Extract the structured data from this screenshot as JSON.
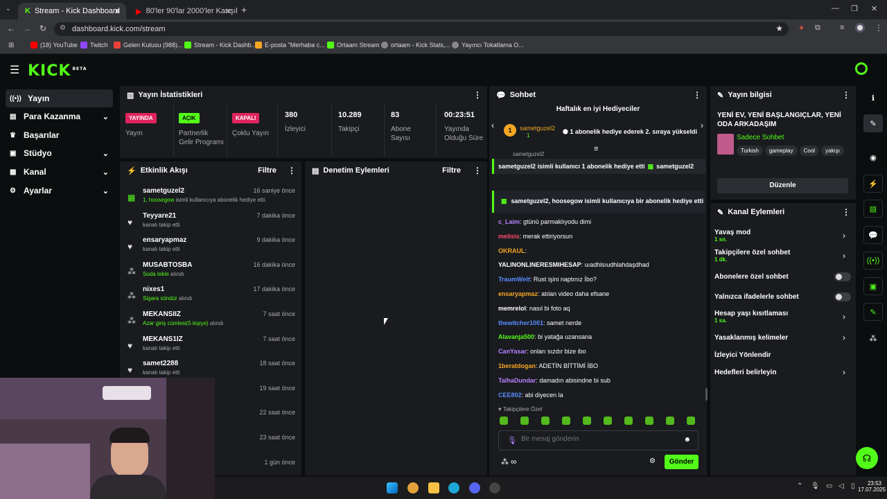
{
  "browser": {
    "tabs": [
      {
        "label": "Stream - Kick Dashboard"
      },
      {
        "label": "80'ler 90'lar 2000'ler Karışık Tür"
      }
    ],
    "url": "dashboard.kick.com/stream",
    "bookmarks": [
      "(18) YouTube",
      "Twitch",
      "Gelen Kutusu (988)...",
      "Stream - Kick Dashb...",
      "E-posta \"Merhaba c...",
      "Ortaam Stream",
      "ortaam - Kick Stats,...",
      "Yayıncı Tokatlama O..."
    ]
  },
  "brand": {
    "logo": "KICK",
    "beta": "BETA",
    "accent": "#53fc18"
  },
  "nav": {
    "items": [
      {
        "label": "Yayın"
      },
      {
        "label": "Para Kazanma"
      },
      {
        "label": "Başarılar"
      },
      {
        "label": "Stüdyo"
      },
      {
        "label": "Kanal"
      },
      {
        "label": "Ayarlar"
      }
    ]
  },
  "stats": {
    "title": "Yayın İstatistikleri",
    "live_badge": "YAYINDA",
    "live_label": "Yayın",
    "partner_badge": "AÇIK",
    "partner_label": "Partnerlik Gelir Programı",
    "multi_badge": "KAPALI",
    "multi_label": "Çoklu Yayın",
    "viewers": "380",
    "viewers_label": "İzleyici",
    "followers": "10.289",
    "followers_label": "Takipçi",
    "subs": "83",
    "subs_label": "Abone Sayısı",
    "uptime": "00:23:51",
    "uptime_label": "Yayında Olduğu Süre"
  },
  "activity": {
    "title": "Etkinlik Akışı",
    "filter": "Filtre",
    "events": [
      {
        "name": "sametguzel2",
        "time": "16 saniye önce",
        "desc_hl": "1, hoosegow",
        "desc": "isimli kullanıcıya abonelik hediye etti."
      },
      {
        "name": "Teyyare21",
        "time": "7 dakika önce",
        "desc_hl": "",
        "desc": "kanalı takip etti"
      },
      {
        "name": "ensaryapmaz",
        "time": "9 dakika önce",
        "desc_hl": "",
        "desc": "kanalı takip etti"
      },
      {
        "name": "MUSABTOSBA",
        "time": "16 dakika önce",
        "desc_hl": "Soda tekle",
        "desc": "alındı"
      },
      {
        "name": "nixes1",
        "time": "17 dakika önce",
        "desc_hl": "Sigara söndür",
        "desc": "alındı"
      },
      {
        "name": "MEKANSIIZ",
        "time": "7 saat önce",
        "desc_hl": "Azar giriş cümlesi(5 kişiye)",
        "desc": "alındı"
      },
      {
        "name": "MEKANS1IZ",
        "time": "7 saat önce",
        "desc_hl": "",
        "desc": "kanalı takip etti"
      },
      {
        "name": "samet2288",
        "time": "18 saat önce",
        "desc_hl": "",
        "desc": "kanalı takip etti"
      },
      {
        "name": "",
        "time": "19 saat önce",
        "desc_hl": "",
        "desc": ""
      },
      {
        "name": "",
        "time": "22 saat önce",
        "desc_hl": "",
        "desc": ""
      },
      {
        "name": "",
        "time": "23 saat önce",
        "desc_hl": "",
        "desc": ""
      },
      {
        "name": "",
        "time": "1 gün önce",
        "desc_hl": "",
        "desc": ""
      }
    ]
  },
  "moderation": {
    "title": "Denetim Eylemleri",
    "filter": "Filtre"
  },
  "chat": {
    "title": "Sohbet",
    "top_gifters": "Haftalık en iyi Hediyeciler",
    "gifter_name": "sametguzel2",
    "gifter_count": "1",
    "gifter_msg": "1 abonelik hediye ederek 2. sıraya yükseldi",
    "peek_name": "sametguzel2",
    "gift_banner": "sametguzel2 isimli kullanıcı 1 abonelik hediye etti",
    "gift_banner_tail": "sametguzel2",
    "gift_event": "sametguzel2, hoosegow isimli kullanıcıya bir abonelik hediye etti",
    "messages": [
      {
        "user": "c_Laim",
        "color": "#b784ff",
        "text": "gtünü parmaklıyodu dimi"
      },
      {
        "user": "melisis",
        "color": "#ff4d6d",
        "text": "merak ettiriyorsun"
      },
      {
        "user": "OKRAUL",
        "color": "#f5a623",
        "text": ""
      },
      {
        "user": "YALINONLINERESMIHESAP",
        "color": "#ffffff",
        "text": "uıadhlsıudhlahdaşdhad"
      },
      {
        "user": "TraumWelt",
        "color": "#5b8cff",
        "text": "Rust işini naptınız İbo?"
      },
      {
        "user": "ensaryapmaz",
        "color": "#f5a623",
        "text": "atılan video daha efsane"
      },
      {
        "user": "memrelol",
        "color": "#ffffff",
        "text": "nasıl bi foto aq"
      },
      {
        "user": "thewitcher1001",
        "color": "#5b8cff",
        "text": "samet nerde"
      },
      {
        "user": "Alavanja500",
        "color": "#53fc18",
        "text": "bi yatağa uzansana"
      },
      {
        "user": "CanYasar",
        "color": "#b784ff",
        "text": "onları sızdır bize ibo"
      },
      {
        "user": "1beratdogan",
        "color": "#f5a623",
        "text": "ADETİN BİTTİMİ İBO"
      },
      {
        "user": "TalhaDundar",
        "color": "#b784ff",
        "text": "damadın abisindne bi sub"
      },
      {
        "user": "CEE802",
        "color": "#5b8cff",
        "text": "abi diyecen la"
      }
    ],
    "followers_only": "Takipçilere Özel",
    "placeholder": "Bir mesaj gönderin",
    "send": "Gönder"
  },
  "stream_info": {
    "title": "Yayın bilgisi",
    "stream_title": "YENİ EV, YENİ BAŞLANGIÇLAR, YENİ ODA ARKADAŞIM",
    "category": "Sadece Sohbet",
    "tags": [
      "Turkish",
      "gameplay",
      "Cool",
      "yakışı"
    ],
    "edit": "Düzenle"
  },
  "channel_actions": {
    "title": "Kanal Eylemleri",
    "items": [
      {
        "label": "Yavaş mod",
        "sub": "1 sn."
      },
      {
        "label": "Takipçilere özel sohbet",
        "sub": "1 dk."
      },
      {
        "label": "Abonelere özel sohbet",
        "sub": ""
      },
      {
        "label": "Yalnızca ifadelerle sohbet",
        "sub": ""
      },
      {
        "label": "Hesap yaşı kısıtlaması",
        "sub": "1 sa."
      },
      {
        "label": "Yasaklanmış kelimeler",
        "sub": ""
      },
      {
        "label": "İzleyici Yönlendir",
        "sub": ""
      },
      {
        "label": "Hedefleri belirleyin",
        "sub": ""
      }
    ]
  },
  "taskbar": {
    "time": "23:53",
    "date": "17.07.2025"
  }
}
